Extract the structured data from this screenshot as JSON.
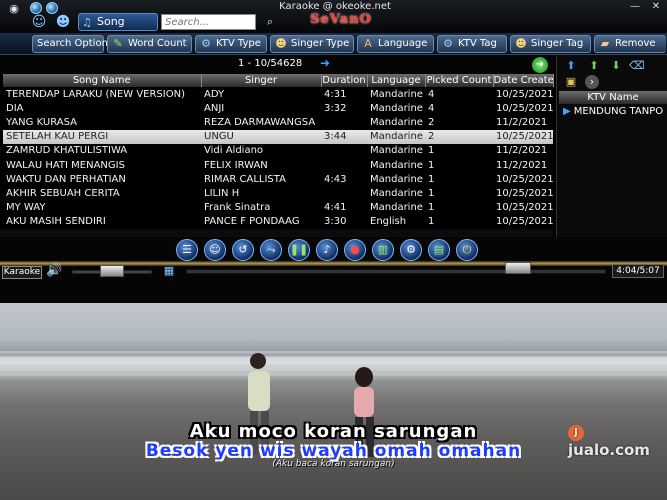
{
  "window": {
    "title": "Karaoke @ okeoke.net",
    "brand": "SeVanO"
  },
  "toolbar": {
    "song_name_label": "Song Name",
    "search_placeholder": "Search..."
  },
  "options": {
    "label": "Search Option",
    "buttons": [
      "Word Count",
      "KTV Type",
      "Singer Type",
      "Language",
      "KTV Tag",
      "Singer Tag",
      "Remove"
    ]
  },
  "list": {
    "page_text": "1 - 10/54628",
    "columns": [
      "Song Name",
      "Singer",
      "Duration",
      "Language",
      "Picked Count",
      "Date Create"
    ],
    "rows": [
      [
        "TERENDAP LARAKU (NEW VERSION)",
        "ADY",
        "4:31",
        "Mandarine",
        "4",
        "10/25/2021"
      ],
      [
        "DIA",
        "ANJI",
        "3:32",
        "Mandarine",
        "4",
        "10/25/2021"
      ],
      [
        "YANG KURASA",
        "REZA DARMAWANGSA",
        "",
        "Mandarine",
        "2",
        "11/2/2021"
      ],
      [
        "SETELAH KAU PERGI",
        "UNGU",
        "3:44",
        "Mandarine",
        "2",
        "10/25/2021"
      ],
      [
        "ZAMRUD KHATULISTIWA",
        "Vidi Aldiano",
        "",
        "Mandarine",
        "1",
        "11/2/2021"
      ],
      [
        "WALAU HATI MENANGIS",
        "FELIX IRWAN",
        "",
        "Mandarine",
        "1",
        "11/2/2021"
      ],
      [
        "WAKTU DAN PERHATIAN",
        "RIMAR CALLISTA",
        "4:43",
        "Mandarine",
        "1",
        "10/25/2021"
      ],
      [
        "AKHIR SEBUAH CERITA",
        "LILIN H",
        "",
        "Mandarine",
        "1",
        "10/25/2021"
      ],
      [
        "MY WAY",
        "Frank Sinatra",
        "4:41",
        "Mandarine",
        "1",
        "10/25/2021"
      ],
      [
        "AKU MASIH SENDIRI",
        "PANCE F PONDAAG",
        "3:30",
        "English",
        "1",
        "10/25/2021"
      ]
    ],
    "selected_index": 3
  },
  "ktv_panel": {
    "header": "KTV Name",
    "item": "MENDUNG TANPO"
  },
  "player": {
    "mode_label": "Karaoke",
    "time": "4:04/5:07",
    "volume": 0.5,
    "progress": 0.79
  },
  "video": {
    "lyric_line1": "Aku moco koran sarungan",
    "lyric_line2": "Besok yen wis wayah omah omahan",
    "translation": "(Aku baca koran sarungan)",
    "watermark": "jualo.com"
  }
}
